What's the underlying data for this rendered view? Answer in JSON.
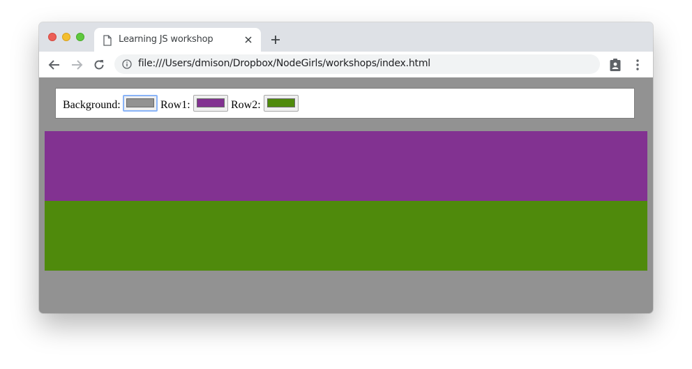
{
  "browser": {
    "tab": {
      "title": "Learning JS workshop",
      "icon": "document-icon"
    },
    "url": "file:///Users/dmison/Dropbox/NodeGirls/workshops/index.html",
    "colors": {
      "tabstrip": "#dee1e6",
      "toolbar": "#ffffff",
      "omnibox": "#f1f3f4"
    }
  },
  "page": {
    "background_color": "#929292",
    "controls": {
      "background": {
        "label": "Background:",
        "value": "#929292"
      },
      "row1": {
        "label": "Row1:",
        "value": "#823291"
      },
      "row2": {
        "label": "Row2:",
        "value": "#4f8a0c"
      }
    },
    "rows": [
      {
        "color": "#823291"
      },
      {
        "color": "#4f8a0c"
      }
    ]
  }
}
